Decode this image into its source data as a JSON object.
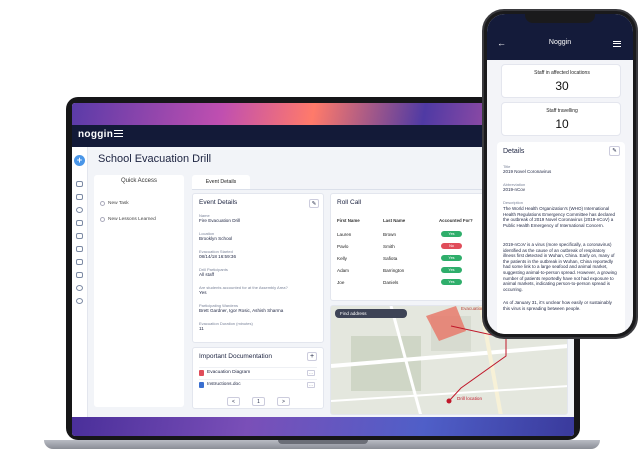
{
  "app": {
    "logo_text": "noggin",
    "page_title": "School Evacuation Drill"
  },
  "quick_access": {
    "title": "Quick Access",
    "items": [
      "New Task",
      "New Lessons Learned"
    ]
  },
  "tabs": [
    "Event Details"
  ],
  "event_details": {
    "title": "Event Details",
    "fields": [
      {
        "label": "Name",
        "value": "Fire Evacuation Drill"
      },
      {
        "label": "Location",
        "value": "Brooklyn School"
      },
      {
        "label": "Evacuation Started",
        "value": "08/14/18 16:59:36"
      },
      {
        "label": "Drill Participants",
        "value": "All staff"
      },
      {
        "label": "Are students accounted for at the Assembly Area?",
        "value": "Yes"
      },
      {
        "label": "Participating Wardens",
        "value": "Brett Gardner, Igor Rosic, Ashish Sharma"
      },
      {
        "label": "Evacuation Duration (minutes)",
        "value": "11"
      }
    ]
  },
  "roll_call": {
    "title": "Roll Call",
    "columns": [
      "First Name",
      "Last Name",
      "Accounted For?"
    ],
    "rows": [
      {
        "first": "Lauren",
        "last": "Brown",
        "status": "Yes"
      },
      {
        "first": "Pavlo",
        "last": "Smith",
        "status": "No"
      },
      {
        "first": "Kelly",
        "last": "Safiota",
        "status": "Yes"
      },
      {
        "first": "Adam",
        "last": "Barrington",
        "status": "Yes"
      },
      {
        "first": "Joe",
        "last": "Daniels",
        "status": "Yes"
      }
    ]
  },
  "map": {
    "find_address": "Find address",
    "evacuation_label": "Evacuation",
    "drill_location_label": "Drill location"
  },
  "documentation": {
    "title": "Important Documentation",
    "files": [
      {
        "name": "Evacuation Diagram",
        "type": "pdf"
      },
      {
        "name": "Instructions.doc",
        "type": "doc"
      }
    ],
    "pagination": {
      "prev": "<",
      "page": "1",
      "next": ">"
    }
  },
  "phone": {
    "title": "Noggin",
    "back": "←",
    "stats": [
      {
        "label": "Staff in affected locations",
        "value": "30"
      },
      {
        "label": "Staff travelling",
        "value": "10"
      }
    ],
    "details": {
      "title": "Details",
      "fields": [
        {
          "label": "Title",
          "value": "2019 Novel Coronavirus"
        },
        {
          "label": "Abbreviation",
          "value": "2019-nCov"
        },
        {
          "label": "Description",
          "value": "The World Health Organization's (WHO) International Health Regulations Emergency Committee has declared the outbreak of 2019 Novel Coronavirus (2019-nCoV) a Public Health Emergency of International Concern."
        }
      ],
      "paragraphs": [
        "2019-nCoV is a virus (more specifically, a coronavirus) identified as the cause of an outbreak of respiratory illness first detected in Wuhan, China. Early on, many of the patients in the outbreak in Wuhan, China reportedly had some link to a large seafood and animal market, suggesting animal-to-person spread. However, a growing number of patients reportedly have not had exposure to animal markets, indicating person-to-person spread is occurring.",
        "As of January 31, it's unclear how easily or sustainably this virus is spreading between people."
      ]
    }
  },
  "colors": {
    "nav_dark": "#131a38",
    "accent_blue": "#4a96e8",
    "yes_green": "#2fae6b",
    "no_red": "#e04d5a"
  }
}
